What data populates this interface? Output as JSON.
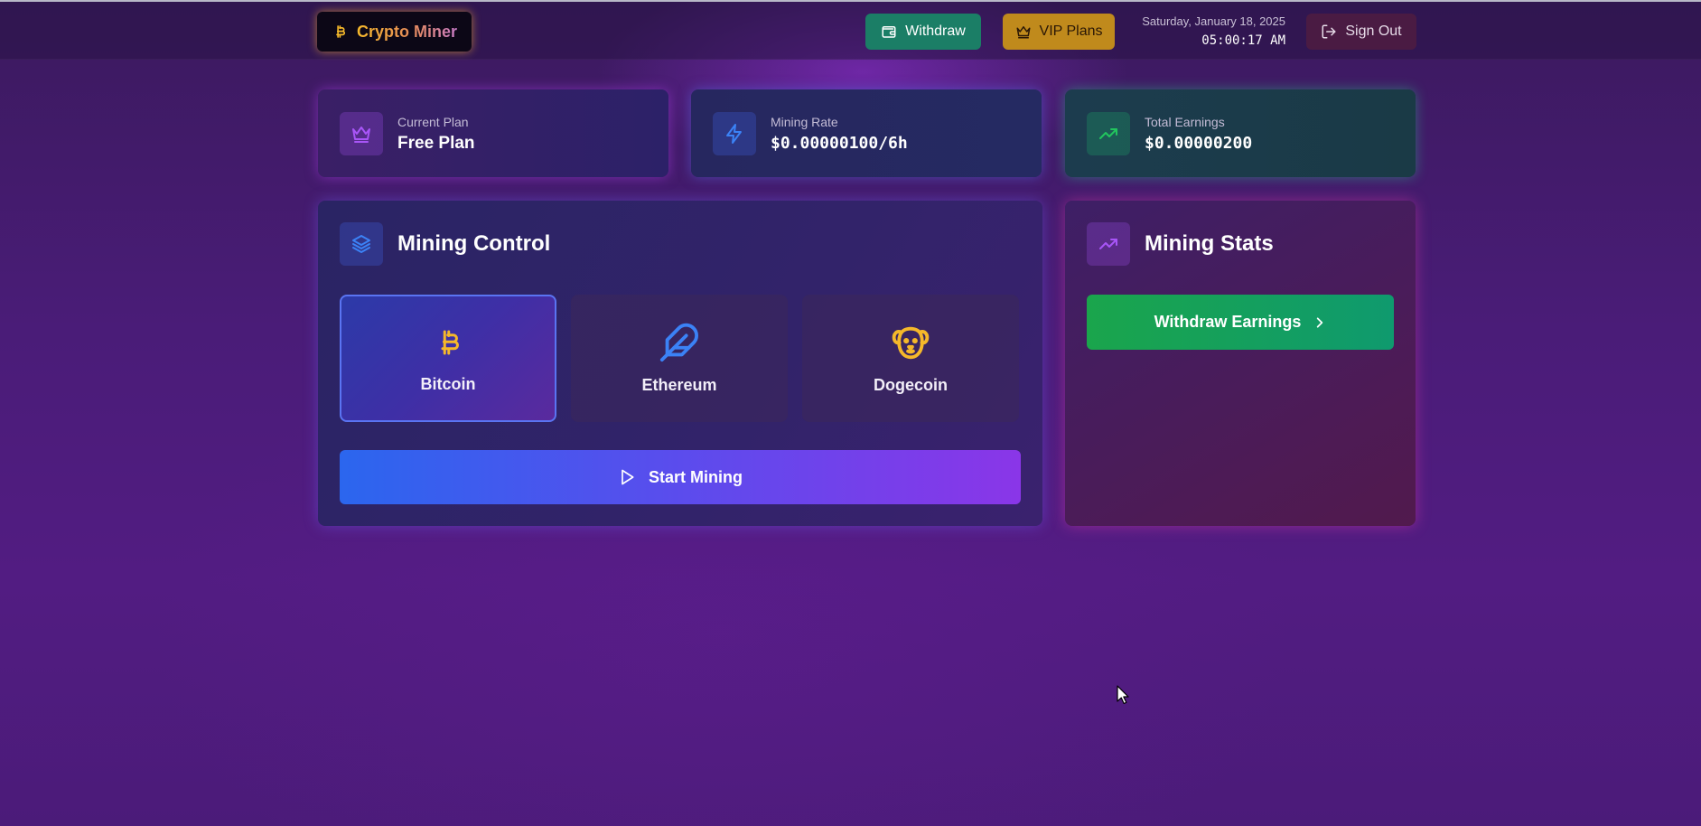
{
  "header": {
    "logo_text": "Crypto Miner",
    "withdraw_label": "Withdraw",
    "vip_label": "VIP Plans",
    "date": "Saturday, January 18, 2025",
    "time": "05:00:17 AM",
    "signout_label": "Sign Out"
  },
  "stats": {
    "plan": {
      "label": "Current Plan",
      "value": "Free Plan",
      "icon": "crown-icon"
    },
    "rate": {
      "label": "Mining Rate",
      "value": "$0.00000100/6h",
      "icon": "lightning-icon"
    },
    "earnings": {
      "label": "Total Earnings",
      "value": "$0.00000200",
      "icon": "trending-up-icon"
    }
  },
  "mining_control": {
    "title": "Mining Control",
    "coins": [
      {
        "label": "Bitcoin",
        "icon": "bitcoin-icon",
        "selected": true
      },
      {
        "label": "Ethereum",
        "icon": "feather-icon",
        "selected": false
      },
      {
        "label": "Dogecoin",
        "icon": "dog-icon",
        "selected": false
      }
    ],
    "start_label": "Start Mining"
  },
  "mining_stats": {
    "title": "Mining Stats",
    "withdraw_label": "Withdraw Earnings"
  },
  "colors": {
    "accent_gold": "#f5b82a",
    "accent_blue": "#3b82f6",
    "accent_green": "#16a34a",
    "accent_purple": "#9333ea"
  }
}
